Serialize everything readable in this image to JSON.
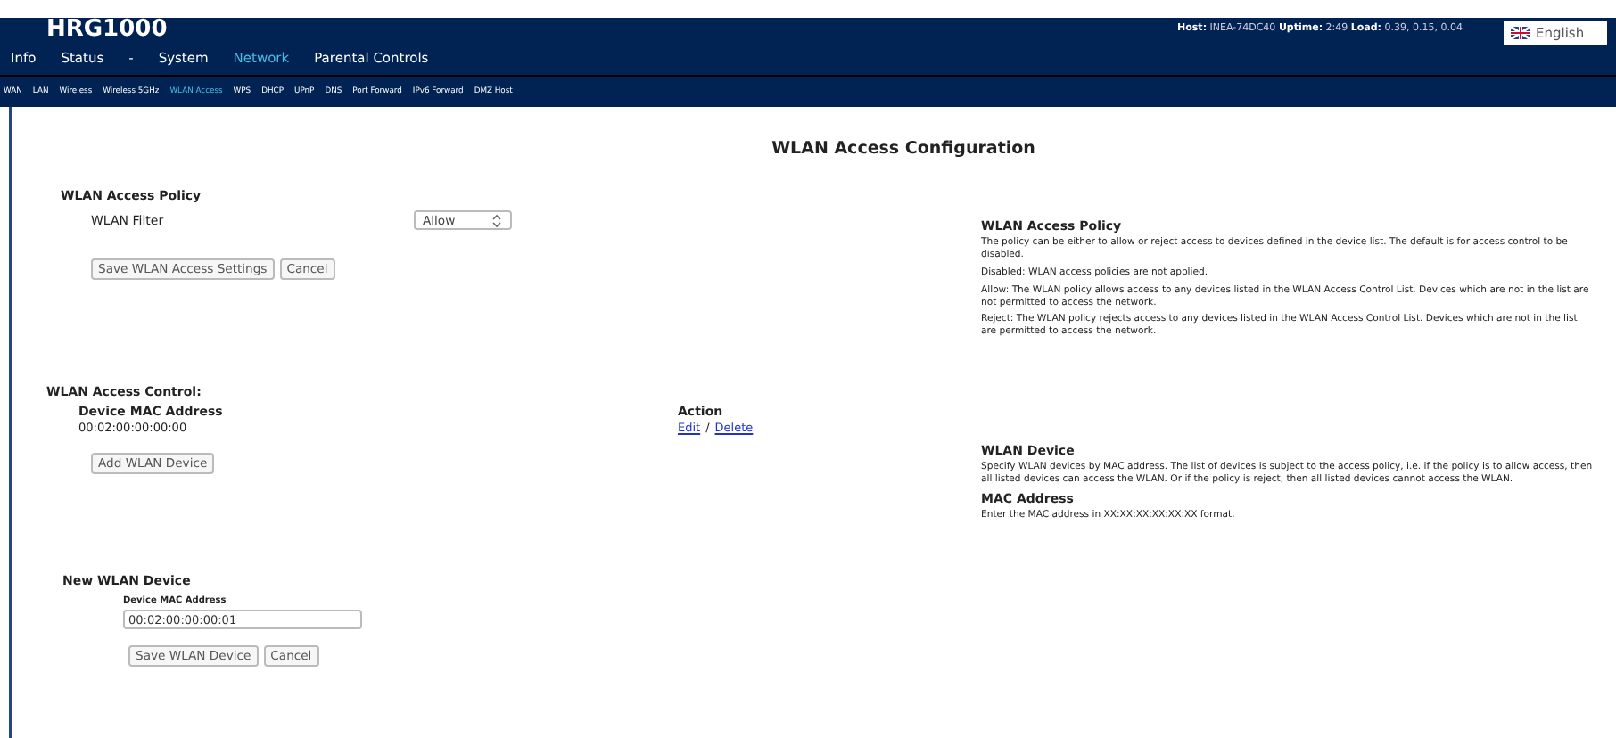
{
  "header": {
    "logo": "HRG1000",
    "status": [
      {
        "label": "Host:",
        "value": "INEA-74DC40"
      },
      {
        "label": "Uptime:",
        "value": "2:49"
      },
      {
        "label": "Load:",
        "value": "0.39, 0.15, 0.04"
      }
    ],
    "language": "English"
  },
  "main_nav": [
    {
      "label": "Info",
      "selected": false
    },
    {
      "label": "Status",
      "selected": false
    },
    {
      "label": "-",
      "selected": false
    },
    {
      "label": "System",
      "selected": false
    },
    {
      "label": "Network",
      "selected": true
    },
    {
      "label": "Parental Controls",
      "selected": false
    }
  ],
  "sub_nav": [
    {
      "label": "WAN",
      "selected": false
    },
    {
      "label": "LAN",
      "selected": false
    },
    {
      "label": "Wireless",
      "selected": false
    },
    {
      "label": "Wireless 5GHz",
      "selected": false
    },
    {
      "label": "WLAN Access",
      "selected": true
    },
    {
      "label": "WPS",
      "selected": false
    },
    {
      "label": "DHCP",
      "selected": false
    },
    {
      "label": "UPnP",
      "selected": false
    },
    {
      "label": "DNS",
      "selected": false
    },
    {
      "label": "Port Forward",
      "selected": false
    },
    {
      "label": "IPv6 Forward",
      "selected": false
    },
    {
      "label": "DMZ Host",
      "selected": false
    }
  ],
  "page_title": "WLAN Access Configuration",
  "policy": {
    "heading": "WLAN Access Policy",
    "filter_label": "WLAN Filter",
    "filter_value": "Allow",
    "buttons": [
      "Save WLAN Access Settings",
      "Cancel"
    ]
  },
  "access_control": {
    "heading": "WLAN Access Control:",
    "columns": [
      "Device MAC Address",
      "Action"
    ],
    "rows": [
      {
        "mac": "00:02:00:00:00:00",
        "actions": [
          "Edit",
          "Delete"
        ],
        "separator": "/"
      }
    ],
    "add_button": "Add WLAN Device"
  },
  "new_device": {
    "heading": "New WLAN Device",
    "field_label": "Device MAC Address",
    "field_value": "00:02:00:00:00:01",
    "buttons": [
      "Save WLAN Device",
      "Cancel"
    ]
  },
  "help": [
    {
      "title": "WLAN Access Policy",
      "paragraphs": [
        "The policy can be either to allow or reject access to devices defined in the device list. The default is for access control to be disabled.",
        "Disabled: WLAN access policies are not applied.",
        "Allow: The WLAN policy allows access to any devices listed in the WLAN Access Control List. Devices which are not in the list are not permitted to access the network.",
        "Reject: The WLAN policy rejects access to any devices listed in the WLAN Access Control List. Devices which are not in the list are permitted to access the network."
      ]
    },
    {
      "title": "WLAN Device",
      "paragraphs": [
        "Specify WLAN devices by MAC address. The list of devices is subject to the access policy, i.e. if the policy is to allow access, then all listed devices can access the WLAN. Or if the policy is reject, then all listed devices cannot access the WLAN."
      ]
    },
    {
      "title": "MAC Address",
      "paragraphs": [
        "Enter the MAC address in XX:XX:XX:XX:XX:XX format."
      ]
    }
  ]
}
